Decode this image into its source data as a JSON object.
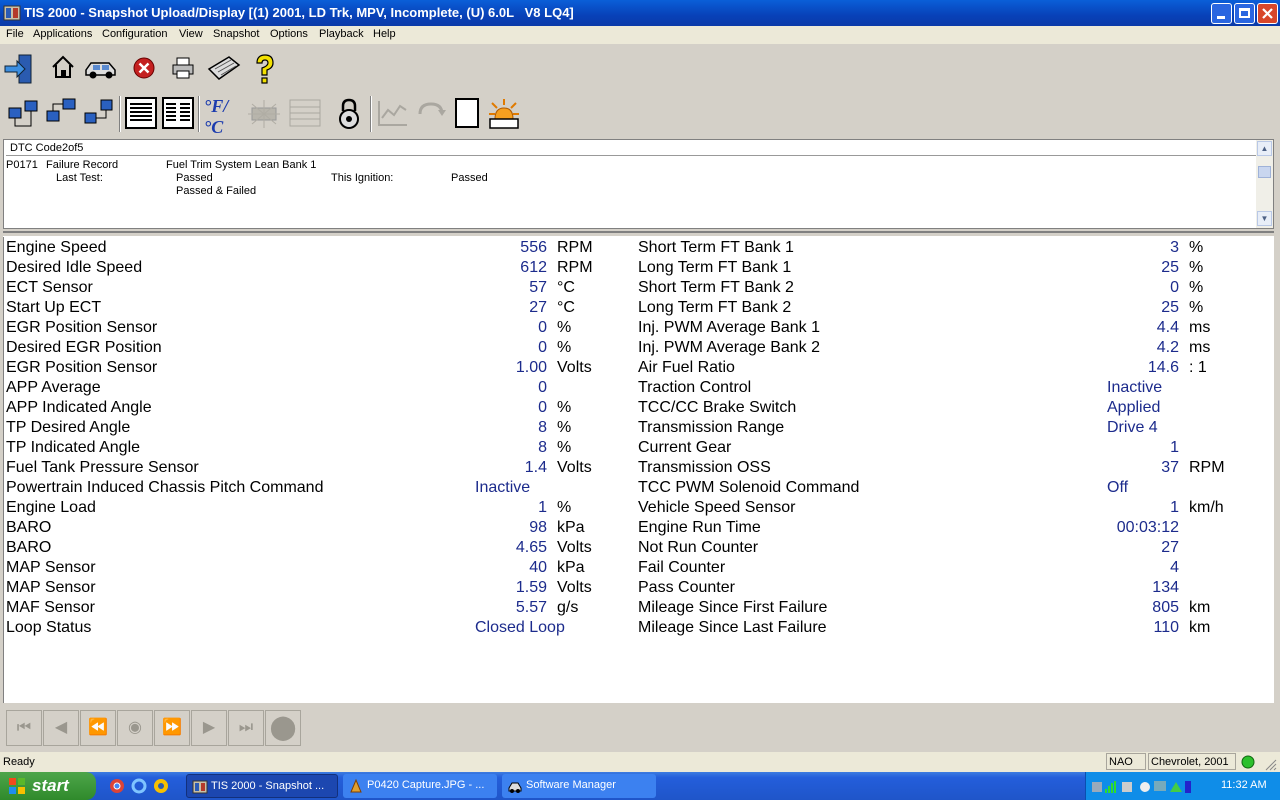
{
  "window": {
    "title": "TIS 2000 - Snapshot Upload/Display [(1) 2001, LD Trk, MPV, Incomplete, (U) 6.0L   V8 LQ4]"
  },
  "menu": [
    "File",
    "Applications",
    "Configuration",
    "View",
    "Snapshot",
    "Options",
    "Playback",
    "Help"
  ],
  "toolbar1": [
    {
      "name": "exit-icon"
    },
    {
      "name": "home-icon"
    },
    {
      "name": "vehicle-icon"
    },
    {
      "name": "stop-icon"
    },
    {
      "name": "printer-icon"
    },
    {
      "name": "keyboard-icon"
    },
    {
      "name": "help-icon"
    }
  ],
  "toolbar2": [
    {
      "name": "network-icon-1"
    },
    {
      "name": "network-icon-2"
    },
    {
      "name": "network-icon-3"
    },
    {
      "name": "list-view-icon"
    },
    {
      "name": "column-view-icon"
    },
    {
      "name": "units-icon",
      "text": "°F/°C"
    },
    {
      "name": "graph-disabled-icon"
    },
    {
      "name": "grid-disabled-icon"
    },
    {
      "name": "lock-icon"
    },
    {
      "name": "chart-disabled-icon"
    },
    {
      "name": "refresh-disabled-icon"
    },
    {
      "name": "blank-page-icon"
    },
    {
      "name": "light-icon"
    }
  ],
  "dtc": {
    "header": "DTC Code2of5",
    "code": "P0171",
    "record": "Failure Record",
    "description": "Fuel Trim System Lean Bank 1",
    "last_test_label": "Last Test:",
    "last_test_1": "Passed",
    "last_test_2": "Passed & Failed",
    "this_ignition_label": "This Ignition:",
    "this_ignition_value": "Passed"
  },
  "left_params": [
    {
      "label": "Engine Speed",
      "value": "556",
      "unit": "RPM"
    },
    {
      "label": "Desired Idle Speed",
      "value": "612",
      "unit": "RPM"
    },
    {
      "label": "ECT Sensor",
      "value": "57",
      "unit": "°C"
    },
    {
      "label": "Start Up ECT",
      "value": "27",
      "unit": "°C"
    },
    {
      "label": "EGR Position Sensor",
      "value": "0",
      "unit": "%"
    },
    {
      "label": "Desired EGR Position",
      "value": "0",
      "unit": "%"
    },
    {
      "label": "EGR Position Sensor",
      "value": "1.00",
      "unit": "Volts"
    },
    {
      "label": "APP Average",
      "value": "0",
      "unit": ""
    },
    {
      "label": "APP Indicated Angle",
      "value": "0",
      "unit": "%"
    },
    {
      "label": "TP Desired Angle",
      "value": "8",
      "unit": "%"
    },
    {
      "label": "TP Indicated Angle",
      "value": "8",
      "unit": "%"
    },
    {
      "label": "Fuel Tank Pressure Sensor",
      "value": "1.4",
      "unit": "Volts"
    },
    {
      "label": "Powertrain Induced Chassis Pitch Command",
      "value": "Inactive",
      "unit": "",
      "text": true
    },
    {
      "label": "Engine Load",
      "value": "1",
      "unit": "%"
    },
    {
      "label": "BARO",
      "value": "98",
      "unit": "kPa"
    },
    {
      "label": "BARO",
      "value": "4.65",
      "unit": "Volts"
    },
    {
      "label": "MAP Sensor",
      "value": "40",
      "unit": "kPa"
    },
    {
      "label": "MAP Sensor",
      "value": "1.59",
      "unit": "Volts"
    },
    {
      "label": "MAF Sensor",
      "value": "5.57",
      "unit": "g/s"
    },
    {
      "label": "Loop Status",
      "value": "Closed Loop",
      "unit": "",
      "text": true
    }
  ],
  "right_params": [
    {
      "label": "Short Term FT Bank 1",
      "value": "3",
      "unit": "%"
    },
    {
      "label": "Long Term FT Bank 1",
      "value": "25",
      "unit": "%"
    },
    {
      "label": "Short Term FT Bank 2",
      "value": "0",
      "unit": "%"
    },
    {
      "label": "Long Term FT Bank 2",
      "value": "25",
      "unit": "%"
    },
    {
      "label": "Inj. PWM Average Bank 1",
      "value": "4.4",
      "unit": "ms"
    },
    {
      "label": "Inj. PWM Average Bank 2",
      "value": "4.2",
      "unit": "ms"
    },
    {
      "label": "Air Fuel Ratio",
      "value": "14.6",
      "unit": ": 1"
    },
    {
      "label": "Traction Control",
      "value": "Inactive",
      "unit": "",
      "text": true
    },
    {
      "label": "TCC/CC Brake Switch",
      "value": "Applied",
      "unit": "",
      "text": true
    },
    {
      "label": "Transmission Range",
      "value": "Drive 4",
      "unit": "",
      "text": true
    },
    {
      "label": "Current Gear",
      "value": "1",
      "unit": ""
    },
    {
      "label": "Transmission OSS",
      "value": "37",
      "unit": "RPM"
    },
    {
      "label": "TCC PWM Solenoid Command",
      "value": "Off",
      "unit": "",
      "text": true
    },
    {
      "label": "Vehicle Speed Sensor",
      "value": "1",
      "unit": "km/h"
    },
    {
      "label": "Engine Run Time",
      "value": "00:03:12",
      "unit": ""
    },
    {
      "label": "Not Run Counter",
      "value": "27",
      "unit": ""
    },
    {
      "label": "Fail Counter",
      "value": "4",
      "unit": ""
    },
    {
      "label": "Pass Counter",
      "value": "134",
      "unit": ""
    },
    {
      "label": "Mileage Since First Failure",
      "value": "805",
      "unit": "km"
    },
    {
      "label": "Mileage Since Last Failure",
      "value": "110",
      "unit": "km"
    }
  ],
  "playback": [
    "first-frame-icon",
    "prev-frame-icon",
    "rewind-icon",
    "record-icon",
    "fast-forward-icon",
    "next-frame-icon",
    "last-frame-icon",
    "stop-playback-icon"
  ],
  "status": {
    "text": "Ready",
    "region": "NAO",
    "vehicle": "Chevrolet, 2001"
  },
  "taskbar": {
    "start": "start",
    "tasks": [
      "TIS 2000 - Snapshot ...",
      "P0420 Capture.JPG - ...",
      "Software Manager"
    ],
    "clock": "11:32 AM"
  }
}
